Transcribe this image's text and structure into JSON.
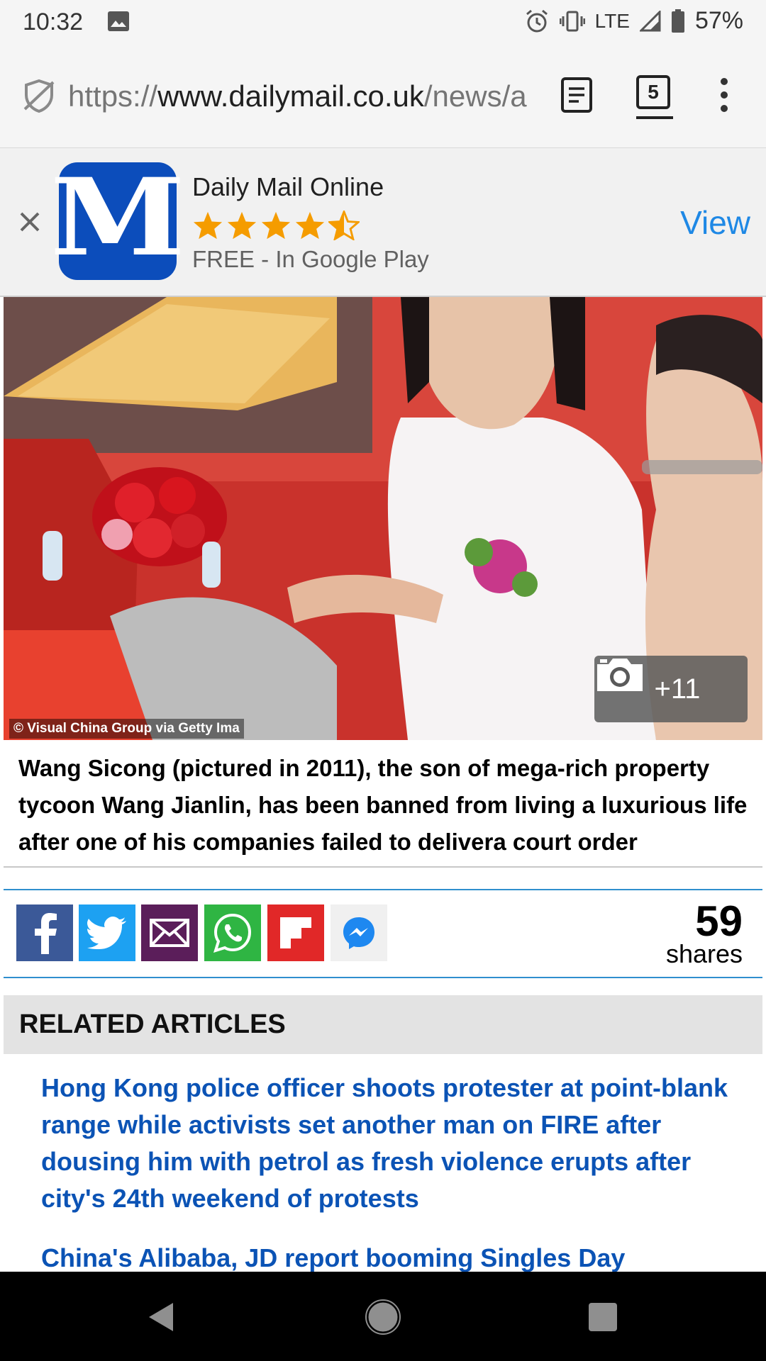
{
  "status_bar": {
    "time": "10:32",
    "network": "LTE",
    "battery": "57%"
  },
  "browser": {
    "url_scheme": "https://",
    "url_host": "www.dailymail.co.uk",
    "url_path": "/news/a",
    "tab_count": "5"
  },
  "app_banner": {
    "app_name": "Daily Mail Online",
    "rating": 4.5,
    "store_text": "FREE - In Google Play",
    "view_label": "View",
    "icon_letter": "M",
    "accent_color": "#1e88e5",
    "star_color": "#f59c00"
  },
  "article": {
    "photo_credit": "© Visual China Group via Getty Ima",
    "gallery_count": "+11",
    "caption": "Wang Sicong (pictured in 2011), the son of mega-rich property tycoon Wang Jianlin, has been banned from living a luxurious life after one of his companies failed to delivera court order"
  },
  "share": {
    "buttons": [
      {
        "name": "facebook-icon",
        "color": "#3b5998"
      },
      {
        "name": "twitter-icon",
        "color": "#1da1f2"
      },
      {
        "name": "email-icon",
        "color": "#5b1e5a"
      },
      {
        "name": "whatsapp-icon",
        "color": "#2fb543"
      },
      {
        "name": "flipboard-icon",
        "color": "#e12828"
      },
      {
        "name": "messenger-icon",
        "color": "#f0f0f0"
      }
    ],
    "count": "59",
    "count_label": "shares"
  },
  "related": {
    "heading": "RELATED ARTICLES",
    "items": [
      {
        "title": "Hong Kong police officer shoots protester at point-blank range while activists set another man on FIRE after dousing him with petrol as fresh violence erupts after city's 24th weekend of protests"
      },
      {
        "title": "China's Alibaba, JD report booming Singles Day"
      }
    ],
    "link_color": "#0b53b5"
  }
}
